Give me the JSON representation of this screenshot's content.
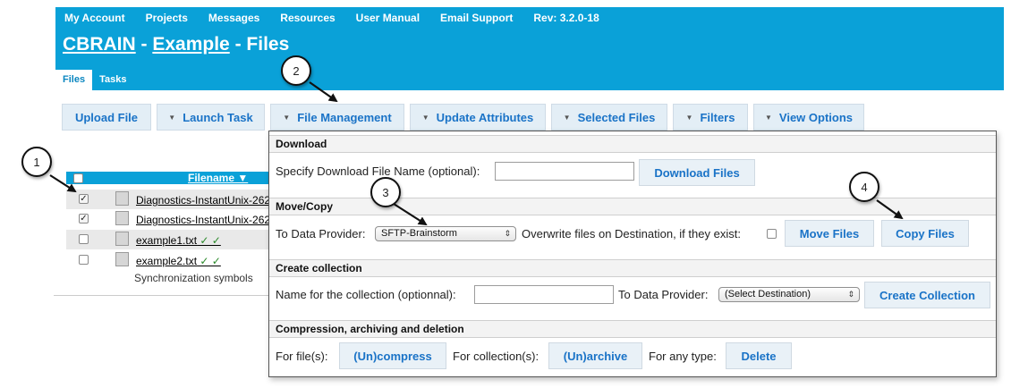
{
  "topnav": {
    "items": [
      "My Account",
      "Projects",
      "Messages",
      "Resources",
      "User Manual",
      "Email Support"
    ],
    "rev": "Rev: 3.2.0-18"
  },
  "heading": {
    "app": "CBRAIN",
    "sep1": " - ",
    "project": "Example",
    "sep2": " - ",
    "section": "Files"
  },
  "tabs": [
    {
      "label": "Files",
      "active": true
    },
    {
      "label": "Tasks",
      "active": false
    }
  ],
  "toolbar": {
    "upload_file": "Upload File",
    "launch_task": "Launch Task",
    "file_management": "File Management",
    "update_attributes": "Update Attributes",
    "selected_files": "Selected Files",
    "filters": "Filters",
    "view_options": "View Options",
    "dropdown_glyph": "▼"
  },
  "file_table": {
    "filename_header": "Filename ▼",
    "rows": [
      {
        "name": "Diagnostics-InstantUnix-262",
        "checked": true,
        "status": ""
      },
      {
        "name": "Diagnostics-InstantUnix-262",
        "checked": true,
        "status": ""
      },
      {
        "name": "example1.txt",
        "checked": false,
        "status": " ✓ ✓"
      },
      {
        "name": "example2.txt",
        "checked": false,
        "status": " ✓ ✓"
      }
    ],
    "sync_note": "Synchronization symbols"
  },
  "menu": {
    "download": {
      "title": "Download",
      "label": "Specify Download File Name (optional):",
      "input_value": "",
      "button": "Download Files"
    },
    "move_copy": {
      "title": "Move/Copy",
      "to_label": "To Data Provider:",
      "provider": "SFTP-Brainstorm",
      "overwrite_label": "Overwrite files on Destination, if they exist:",
      "overwrite_checked": false,
      "move_button": "Move Files",
      "copy_button": "Copy Files"
    },
    "collection": {
      "title": "Create collection",
      "name_label": "Name for the collection (optionnal):",
      "input_value": "",
      "to_label": "To Data Provider:",
      "destination": "(Select Destination)",
      "button": "Create Collection"
    },
    "compression": {
      "title": "Compression, archiving and deletion",
      "files_label": "For file(s):",
      "compress_button": "(Un)compress",
      "collections_label": "For collection(s):",
      "archive_button": "(Un)archive",
      "any_label": "For any type:",
      "delete_button": "Delete"
    }
  },
  "callouts": [
    "1",
    "2",
    "3",
    "4"
  ],
  "colors": {
    "header": "#0aa1d8",
    "link": "#1a73c7",
    "check": "#2a8a2a"
  },
  "checkmark": "✓",
  "select_arrows": "⇕"
}
